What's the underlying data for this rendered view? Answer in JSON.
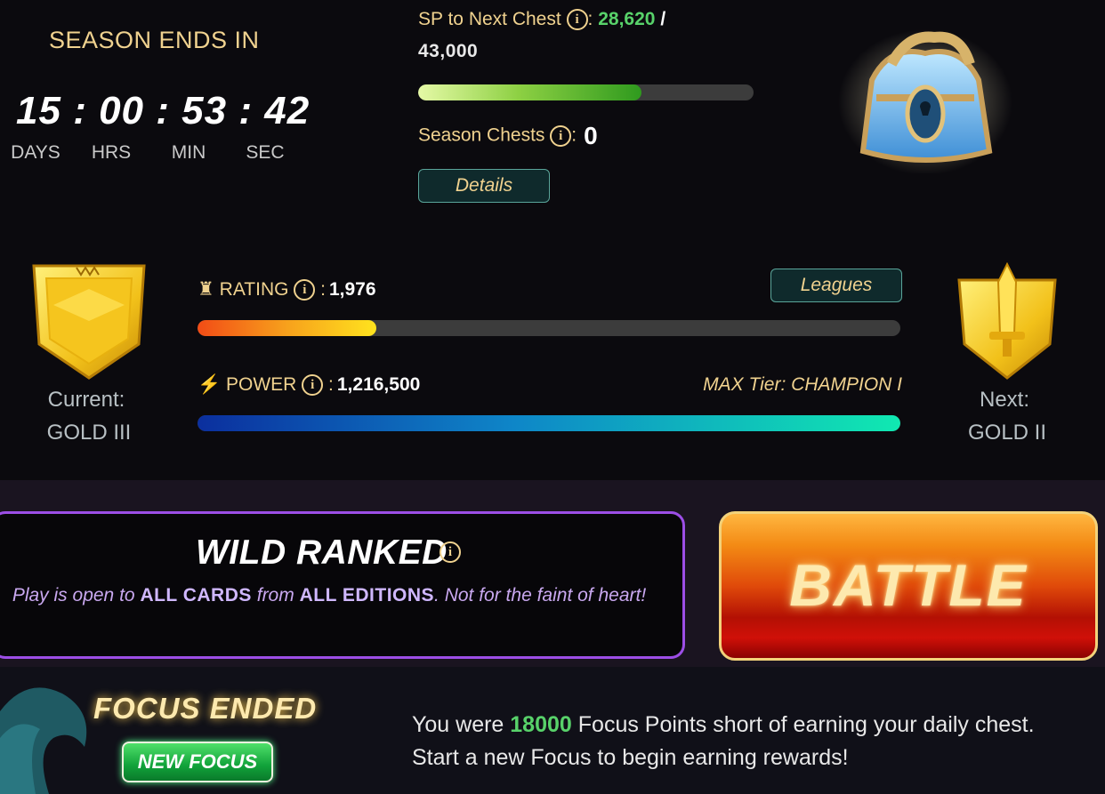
{
  "season": {
    "title": "SEASON ENDS IN",
    "timer": {
      "days": "15",
      "hrs": "00",
      "min": "53",
      "sec": "42",
      "sep": ":"
    },
    "labels": {
      "days": "DAYS",
      "hrs": "HRS",
      "min": "MIN",
      "sec": "SEC"
    }
  },
  "chest": {
    "sp_label": "SP to Next Chest",
    "sp_colon": ":",
    "sp_current": "28,620",
    "sp_slash": "/",
    "sp_total": "43,000",
    "sp_progress": 0.6656,
    "season_chests_label": "Season Chests",
    "season_chests_colon": ":",
    "season_chests_value": "0",
    "details_label": "Details"
  },
  "rank": {
    "current_label": "Current:",
    "current_league": "GOLD III",
    "next_label": "Next:",
    "next_league": "GOLD II",
    "rating_label": "RATING",
    "rating_colon": ":",
    "rating_value": "1,976",
    "rating_progress": 0.255,
    "leagues_label": "Leagues",
    "power_label": "POWER",
    "power_colon": ":",
    "power_value": "1,216,500",
    "power_progress": 1.0,
    "max_tier": "MAX Tier: CHAMPION I"
  },
  "mode": {
    "title": "WILD RANKED",
    "desc_1": "Play is open to",
    "desc_2": "ALL CARDS",
    "desc_3": "from",
    "desc_4": "ALL EDITIONS",
    "desc_5": ". Not for the faint of heart!"
  },
  "battle": {
    "label": "BATTLE"
  },
  "focus": {
    "title": "FOCUS ENDED",
    "new_focus_label": "NEW FOCUS",
    "msg_1": "You were",
    "msg_points": "18000",
    "msg_2": "Focus Points short of earning your daily chest. Start a new Focus to begin earning rewards!"
  },
  "icons": {
    "info": "info-icon",
    "rating": "rating-badge-icon",
    "power": "lightning-icon",
    "chest": "chest-icon",
    "shield_current": "gold-shield-icon",
    "shield_next": "gold-shield-sword-icon",
    "wave": "wave-icon"
  },
  "colors": {
    "gold_text": "#f0d28f",
    "green_value": "#58d26a",
    "mode_border": "#9c4ee6",
    "battle_orange": "#f38a14",
    "battle_red": "#b31004"
  }
}
